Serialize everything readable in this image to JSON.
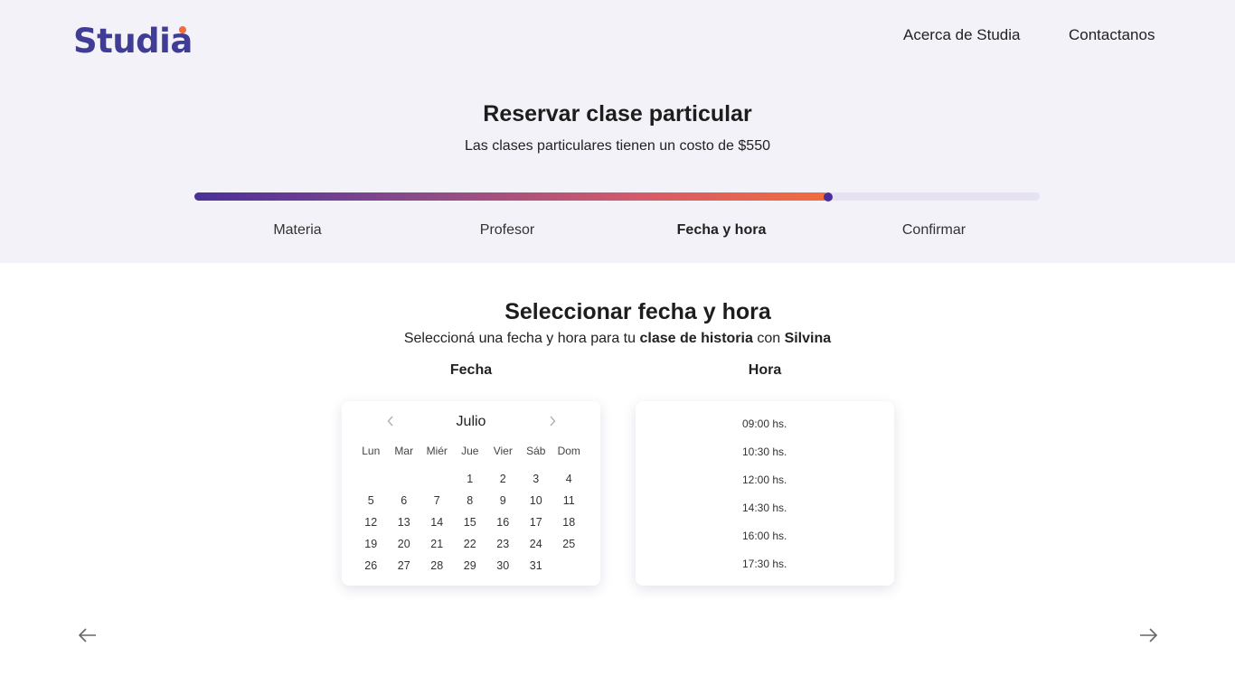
{
  "header": {
    "logo": "Studia",
    "nav": [
      "Acerca de Studia",
      "Contactanos"
    ]
  },
  "page": {
    "title": "Reservar clase particular",
    "subtitle": "Las clases particulares tienen un costo de $550"
  },
  "progress": {
    "value_percent": 75,
    "steps": [
      {
        "label": "Materia",
        "active": false
      },
      {
        "label": "Profesor",
        "active": false
      },
      {
        "label": "Fecha y hora",
        "active": true
      },
      {
        "label": "Confirmar",
        "active": false
      }
    ],
    "colors": {
      "start": "#4a2f9a",
      "end": "#f26c3d",
      "track": "#e6e2f2"
    }
  },
  "section": {
    "title": "Seleccionar fecha y hora",
    "subtitle_prefix": "Seleccioná una fecha y hora para tu",
    "subject": "clase de historia",
    "connector": "con",
    "teacher": "Silvina"
  },
  "date_picker": {
    "label": "Fecha",
    "month": "Julio",
    "prev_icon": "chevron-left-icon",
    "next_icon": "chevron-right-icon",
    "weekdays": [
      "Lun",
      "Mar",
      "Miér",
      "Jue",
      "Vier",
      "Sáb",
      "Dom"
    ],
    "weeks": [
      [
        "",
        "",
        "",
        "1",
        "2",
        "3",
        "4"
      ],
      [
        "5",
        "6",
        "7",
        "8",
        "9",
        "10",
        "11"
      ],
      [
        "12",
        "13",
        "14",
        "15",
        "16",
        "17",
        "18"
      ],
      [
        "19",
        "20",
        "21",
        "22",
        "23",
        "24",
        "25"
      ],
      [
        "26",
        "27",
        "28",
        "29",
        "30",
        "31",
        ""
      ]
    ]
  },
  "time_picker": {
    "label": "Hora",
    "times": [
      "09:00 hs.",
      "10:30 hs.",
      "12:00 hs.",
      "14:30 hs.",
      "16:00 hs.",
      "17:30 hs."
    ]
  },
  "footer_nav": {
    "back_icon": "arrow-left-icon",
    "next_icon": "arrow-right-icon"
  },
  "colors": {
    "brand": "#3f3d96",
    "accent": "#f26c3d",
    "header_bg": "#f3f2f8"
  }
}
